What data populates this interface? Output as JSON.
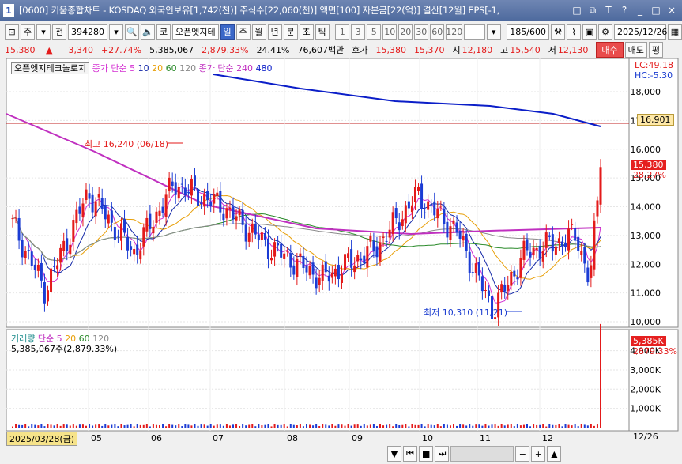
{
  "window": {
    "num": "1",
    "title": "[0600] 키움종합차트 - KOSDAQ 외국인보유[1,742(천)] 주식수[22,060(천)] 액면[100] 자본금[22(억)] 결산[12월] EPS[-1,",
    "buttons": [
      "□",
      "⧉",
      "T",
      "?",
      "_",
      "□",
      "×"
    ]
  },
  "toolbar": {
    "market": "주",
    "whole": "전",
    "code": "394280",
    "name": "오픈엣지테",
    "prefix": "코",
    "periods": [
      "일",
      "주",
      "월",
      "년",
      "분",
      "초",
      "틱"
    ],
    "nums": [
      "1",
      "3",
      "5",
      "10",
      "20",
      "30",
      "60",
      "120"
    ],
    "count": "185",
    "count_total": "/600",
    "date": "2025/12/26"
  },
  "info": {
    "price": "15,380",
    "arrow": "▲",
    "change": "3,340",
    "rate": "+27.74%",
    "volume": "5,385,067",
    "vol_rate": "2,879.33%",
    "turnover": "24.41%",
    "amount": "76,607백만",
    "ask_label": "호가",
    "ask": "15,380",
    "bid": "15,370",
    "open_label": "시",
    "open": "12,180",
    "high_label": "고",
    "high": "15,540",
    "low_label": "저",
    "low": "12,130",
    "buy": "매수",
    "sell": "매도",
    "eval": "평"
  },
  "price_legend": {
    "name": "오픈엣지테크놀로지",
    "ma_label": "종가 단순",
    "ma": [
      "5",
      "10",
      "20",
      "60",
      "120"
    ],
    "ma2_label": "종가 단순",
    "ma2": [
      "240",
      "480"
    ],
    "colors": [
      "#d42fd2",
      "#1428a8",
      "#e89f08",
      "#2a8a2a",
      "#8a8a8a",
      "#c030c0",
      "#0b1ec8"
    ]
  },
  "price_axis": {
    "ticks": [
      "18,000",
      "17,000",
      "16,000",
      "15,000",
      "14,000",
      "13,000",
      "12,000",
      "11,000",
      "10,000"
    ],
    "lc": "LC:49.18",
    "hc": "HC:-5.30",
    "line_value": "16,901",
    "current": "15,380",
    "current_rate": "28.27%"
  },
  "annotations": {
    "high": "최고 16,240 (06/18)",
    "low": "최저 10,310 (11/21)"
  },
  "volume_legend": {
    "label": "거래량",
    "ma_label": "단순",
    "ma": [
      "5",
      "20",
      "60",
      "120"
    ],
    "value": "5,385,067주(2,879.33%)",
    "axis": [
      "4,000K",
      "3,000K",
      "2,000K",
      "1,000K"
    ],
    "current": "5,385K",
    "current_rate": "2879.33%"
  },
  "x_axis": {
    "start": "2025/03/28(금)",
    "months": [
      "05",
      "06",
      "07",
      "08",
      "09",
      "10",
      "11",
      "12"
    ],
    "end": "12/26"
  }
}
